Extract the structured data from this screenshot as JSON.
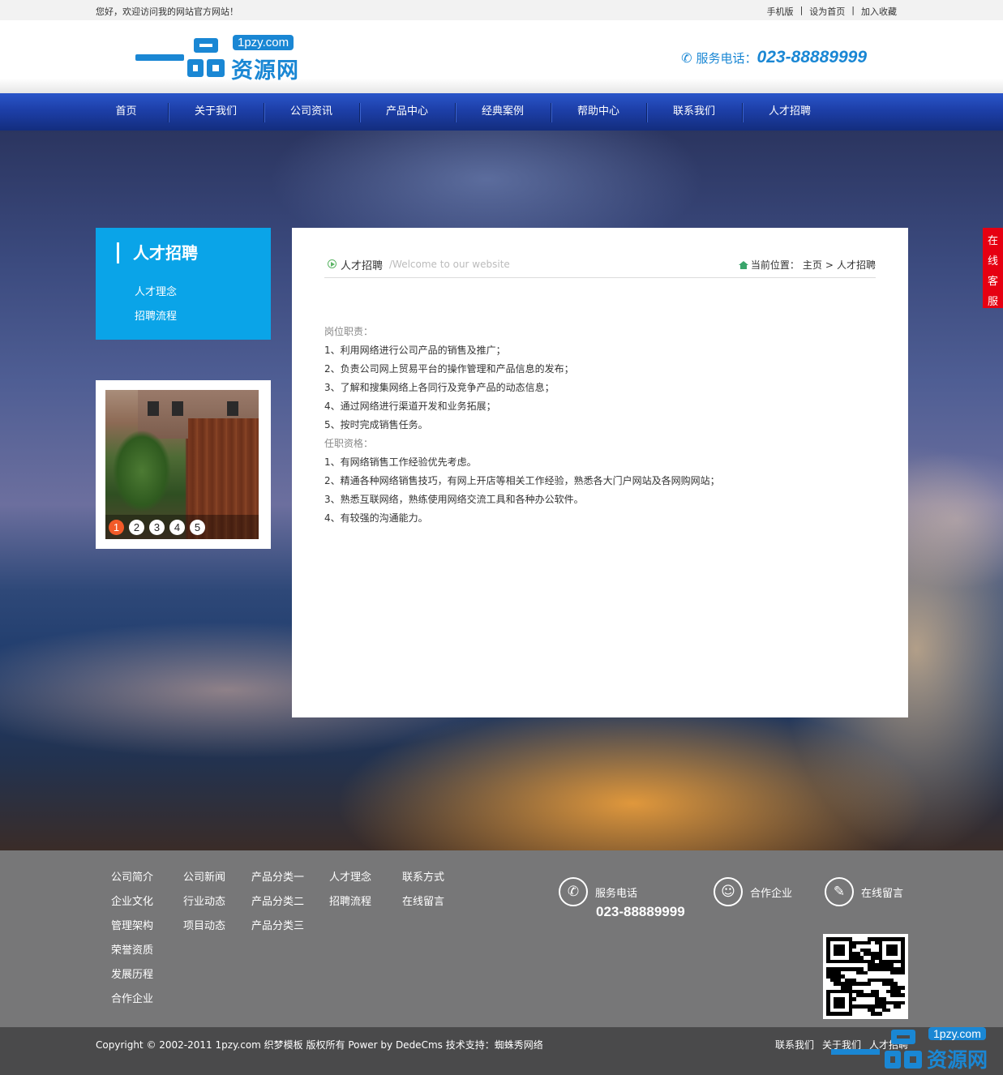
{
  "topbar": {
    "welcome": "您好，欢迎访问我的网站官方网站！",
    "links": [
      "手机版",
      "设为首页",
      "加入收藏"
    ],
    "separator": "|"
  },
  "header": {
    "logo_domain": "1pzy.com",
    "logo_text": "资源网",
    "phone_label": "服务电话：",
    "phone_number": "023-88889999"
  },
  "nav": [
    "首页",
    "关于我们",
    "公司资讯",
    "产品中心",
    "经典案例",
    "帮助中心",
    "联系我们",
    "人才招聘"
  ],
  "sidebar": {
    "title": "人才招聘",
    "items": [
      "人才理念",
      "招聘流程"
    ],
    "slideshow_pages": [
      "1",
      "2",
      "3",
      "4",
      "5"
    ],
    "active_slide": 1
  },
  "main": {
    "title": "人才招聘",
    "subtitle": "/Welcome to our website",
    "breadcrumb_label": "当前位置：",
    "breadcrumb": [
      "主页",
      "人才招聘"
    ],
    "breadcrumb_sep": ">",
    "lines": [
      {
        "text": "岗位职责：",
        "gray": true
      },
      {
        "text": "1、利用网络进行公司产品的销售及推广；",
        "gray": false
      },
      {
        "text": "2、负责公司网上贸易平台的操作管理和产品信息的发布；",
        "gray": false
      },
      {
        "text": "3、了解和搜集网络上各同行及竞争产品的动态信息；",
        "gray": false
      },
      {
        "text": "4、通过网络进行渠道开发和业务拓展；",
        "gray": false
      },
      {
        "text": "5、按时完成销售任务。",
        "gray": false
      },
      {
        "text": "任职资格：",
        "gray": true
      },
      {
        "text": "1、有网络销售工作经验优先考虑。",
        "gray": false
      },
      {
        "text": "2、精通各种网络销售技巧，有网上开店等相关工作经验，熟悉各大门户网站及各网购网站；",
        "gray": false
      },
      {
        "text": "3、熟悉互联网络，熟练使用网络交流工具和各种办公软件。",
        "gray": false
      },
      {
        "text": "4、有较强的沟通能力。",
        "gray": false
      }
    ]
  },
  "kefu": [
    "在",
    "线",
    "客",
    "服"
  ],
  "footer": {
    "columns": [
      [
        "公司简介",
        "企业文化",
        "管理架构",
        "荣誉资质",
        "发展历程",
        "合作企业"
      ],
      [
        "公司新闻",
        "行业动态",
        "项目动态"
      ],
      [
        "产品分类一",
        "产品分类二",
        "产品分类三"
      ],
      [
        "人才理念",
        "招聘流程"
      ],
      [
        "联系方式",
        "在线留言"
      ]
    ],
    "contacts": [
      {
        "label": "服务电话",
        "icon": "phone-icon"
      },
      {
        "label": "合作企业",
        "icon": "user-icon"
      },
      {
        "label": "在线留言",
        "icon": "message-icon"
      }
    ],
    "phone_number": "023-88889999"
  },
  "copyright": {
    "text": "Copyright © 2002-2011 1pzy.com 织梦模板 版权所有 Power by DedeCms 技术支持：蜘蛛秀网络",
    "links": [
      "联系我们",
      "关于我们",
      "人才招聘"
    ]
  },
  "watermark": {
    "domain": "1pzy.com",
    "text": "资源网"
  },
  "colors": {
    "accent": "#1a87d4",
    "sidebar": "#0aa4e8",
    "nav": "#1d3fa8",
    "kefu": "#e60012",
    "active_dot": "#f25a29"
  }
}
